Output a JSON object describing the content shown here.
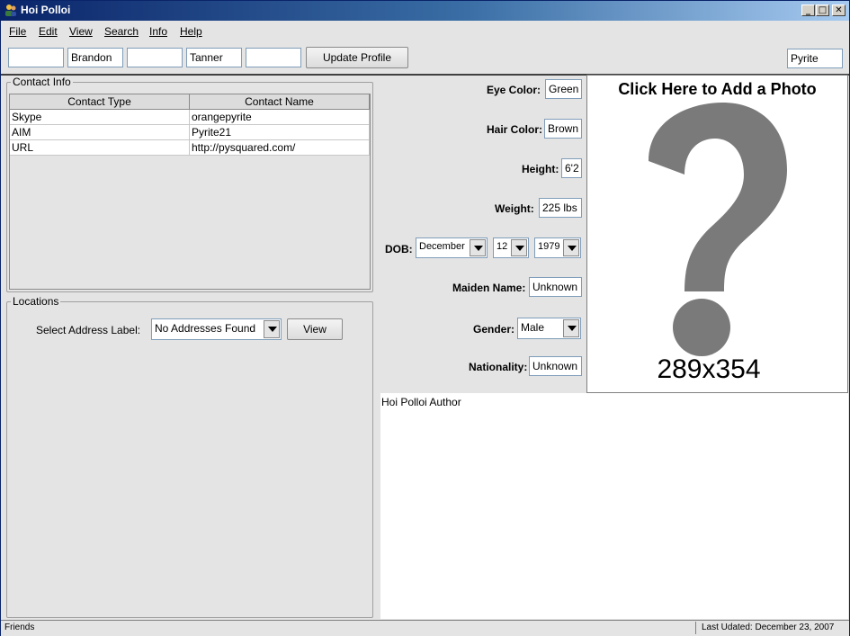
{
  "window": {
    "title": "Hoi Polloi"
  },
  "menu": [
    {
      "label": "File"
    },
    {
      "label": "Edit"
    },
    {
      "label": "View"
    },
    {
      "label": "Search"
    },
    {
      "label": "Info"
    },
    {
      "label": "Help"
    }
  ],
  "toolbar": {
    "name_fields": [
      "",
      "Brandon",
      "",
      "Tanner",
      ""
    ],
    "update_label": "Update Profile",
    "nickname": "Pyrite"
  },
  "contact_info": {
    "title": "Contact Info",
    "columns": [
      "Contact Type",
      "Contact Name"
    ],
    "rows": [
      {
        "type": "Skype",
        "name": "orangepyrite"
      },
      {
        "type": "AIM",
        "name": "Pyrite21"
      },
      {
        "type": "URL",
        "name": "http://pysquared.com/"
      }
    ]
  },
  "locations": {
    "title": "Locations",
    "address_label": "Select Address Label:",
    "address_value": "No Addresses Found",
    "view_label": "View"
  },
  "profile": {
    "eye_color_label": "Eye Color:",
    "eye_color": "Green",
    "hair_color_label": "Hair Color:",
    "hair_color": "Brown",
    "height_label": "Height:",
    "height": "6'2",
    "weight_label": "Weight:",
    "weight": "225 lbs",
    "dob_label": "DOB:",
    "dob_month": "December",
    "dob_day": "12",
    "dob_year": "1979",
    "maiden_label": "Maiden Name:",
    "maiden": "Unknown",
    "gender_label": "Gender:",
    "gender": "Male",
    "nationality_label": "Nationality:",
    "nationality": "Unknown"
  },
  "photo": {
    "title": "Click Here to Add a Photo",
    "dimensions": "289x354",
    "question_color": "#7a7a7a"
  },
  "notes": {
    "text": "Hoi Polloi Author"
  },
  "status": {
    "left": "Friends",
    "right": "Last Udated: December 23, 2007"
  }
}
